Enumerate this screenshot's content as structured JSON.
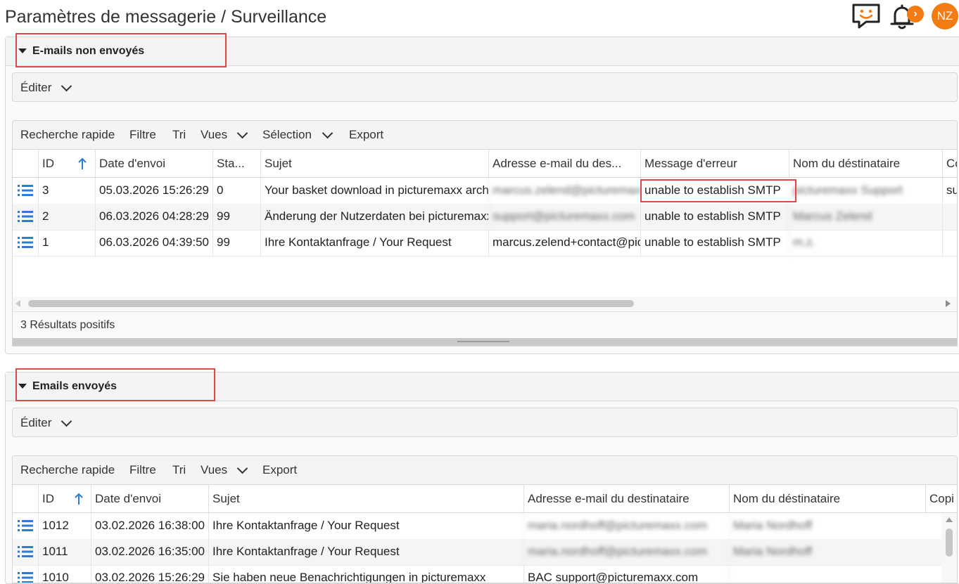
{
  "header": {
    "title": "Paramètres de messagerie / Surveillance",
    "avatar_initials": "NZ",
    "badge_glyph": "›",
    "accent_color": "#f27b13",
    "icons": [
      "chat-smile-icon",
      "bell-icon"
    ]
  },
  "unsent": {
    "title": "E-mails non envoyés",
    "edit_label": "Éditer",
    "toolbar": {
      "quick_search": "Recherche rapide",
      "filter": "Filtre",
      "sort": "Tri",
      "views": "Vues",
      "selection": "Sélection",
      "export": "Export"
    },
    "columns": [
      "ID",
      "Date d'envoi",
      "Sta...",
      "Sujet",
      "Adresse e-mail du des...",
      "Message d'erreur",
      "Nom du déstinataire",
      "Co"
    ],
    "rows": [
      {
        "id": "3",
        "date": "05.03.2026 15:26:29",
        "status": "0",
        "subject": "Your basket download in picturemaxx archive",
        "email": "marcus.zelend@picturemaxx.com",
        "error": "unable to establish SMTP",
        "name": "picturemaxx Support",
        "copy": "su"
      },
      {
        "id": "2",
        "date": "06.03.2026 04:28:29",
        "status": "99",
        "subject": "Änderung der Nutzerdaten bei picturemaxx",
        "email": "support@picturemaxx.com",
        "error": "unable to establish SMTP",
        "name": "Marcus Zelend",
        "copy": ""
      },
      {
        "id": "1",
        "date": "06.03.2026 04:39:50",
        "status": "99",
        "subject": "Ihre Kontaktanfrage / Your Request",
        "email": "marcus.zelend+contact@picturemaxx.com",
        "error": "unable to establish SMTP",
        "name": "m.z.",
        "copy": ""
      }
    ],
    "results": "3 Résultats positifs"
  },
  "sent": {
    "title": "Emails envoyés",
    "edit_label": "Éditer",
    "toolbar": {
      "quick_search": "Recherche rapide",
      "filter": "Filtre",
      "sort": "Tri",
      "views": "Vues",
      "export": "Export"
    },
    "columns": [
      "ID",
      "Date d'envoi",
      "Sujet",
      "Adresse e-mail du destinataire",
      "Nom du déstinataire",
      "Copi"
    ],
    "rows": [
      {
        "id": "1012",
        "date": "03.02.2026 16:38:00",
        "subject": "Ihre Kontaktanfrage / Your Request",
        "email": "maria.nordhoff@picturemaxx.com",
        "name": "Maria Nordhoff"
      },
      {
        "id": "1011",
        "date": "03.02.2026 16:35:00",
        "subject": "Ihre Kontaktanfrage / Your Request",
        "email": "maria.nordhoff@picturemaxx.com",
        "name": "Maria Nordhoff"
      },
      {
        "id": "1010",
        "date": "03.02.2026 15:26:29",
        "subject": "Sie haben neue Benachrichtigungen in picturemaxx",
        "email": "BAC support@picturemaxx.com",
        "name": ""
      }
    ]
  }
}
